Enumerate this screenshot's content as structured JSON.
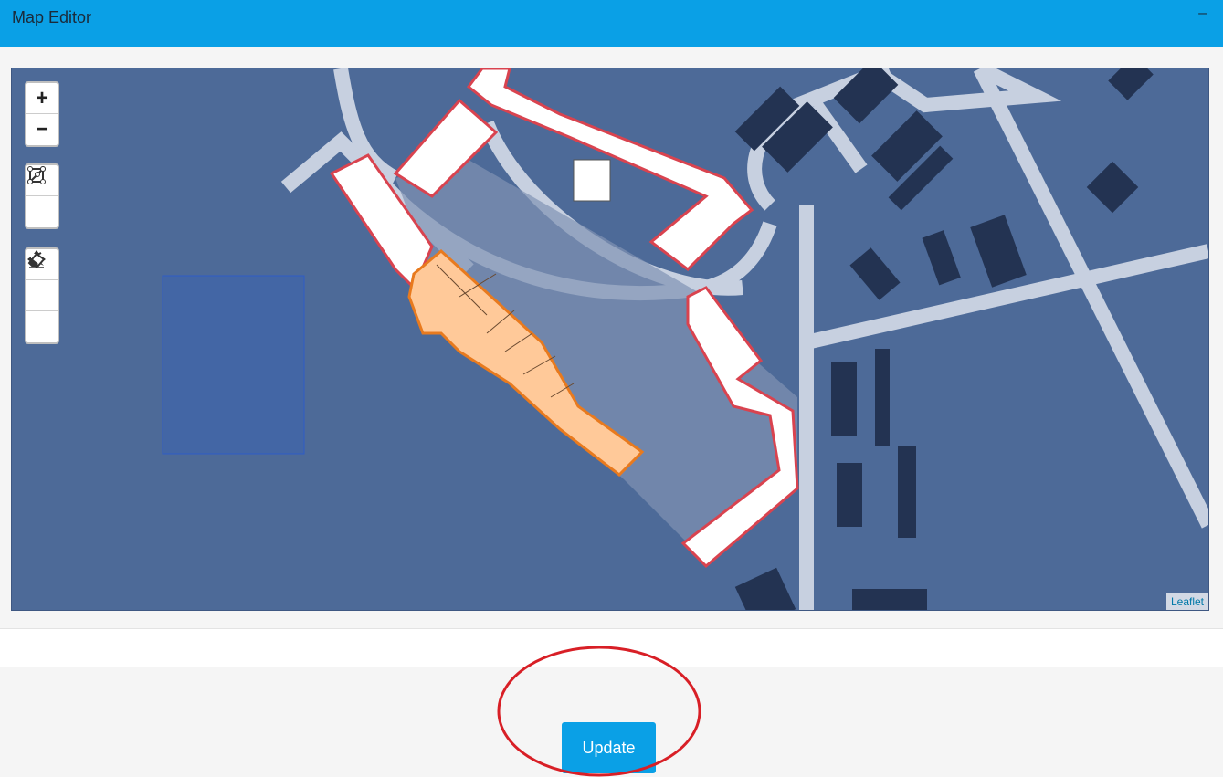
{
  "header": {
    "title": "Map Editor",
    "minimize_label": "–"
  },
  "map": {
    "zoom_in_label": "+",
    "zoom_out_label": "−",
    "tools": [
      {
        "name": "draw-rectangle",
        "icon": "rectangle-icon"
      },
      {
        "name": "draw-polyline",
        "icon": "polyline-icon"
      },
      {
        "name": "cut",
        "icon": "cut-icon"
      },
      {
        "name": "drag",
        "icon": "move-icon"
      },
      {
        "name": "remove",
        "icon": "eraser-icon"
      }
    ],
    "attribution": "Leaflet"
  },
  "footer": {
    "update_label": "Update"
  },
  "colors": {
    "header_bg": "#0aa0e6",
    "map_bg": "#4d6a98",
    "selected_polygon": "#ffc999",
    "selected_stroke": "#e87a1e",
    "building_outline": "#d9434f",
    "highlight_circle": "#d81f26"
  }
}
